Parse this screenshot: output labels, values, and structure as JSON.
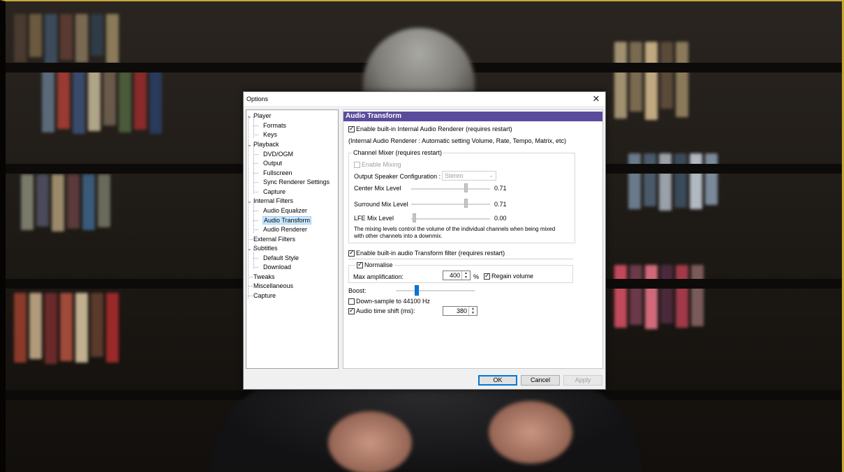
{
  "dialog": {
    "title": "Options",
    "close_glyph": "✕"
  },
  "tree": {
    "items": [
      {
        "label": "Player",
        "expanded": true
      },
      {
        "label": "Formats"
      },
      {
        "label": "Keys"
      },
      {
        "label": "Playback",
        "expanded": true
      },
      {
        "label": "DVD/OGM"
      },
      {
        "label": "Output"
      },
      {
        "label": "Fullscreen"
      },
      {
        "label": "Sync Renderer Settings"
      },
      {
        "label": "Capture"
      },
      {
        "label": "Internal Filters",
        "expanded": true
      },
      {
        "label": "Audio Equalizer"
      },
      {
        "label": "Audio Transform",
        "selected": true
      },
      {
        "label": "Audio Renderer"
      },
      {
        "label": "External Filters"
      },
      {
        "label": "Subtitles",
        "expanded": true
      },
      {
        "label": "Default Style"
      },
      {
        "label": "Download"
      },
      {
        "label": "Tweaks"
      },
      {
        "label": "Miscellaneous"
      },
      {
        "label": "Capture"
      }
    ],
    "expander_glyph": "⌄"
  },
  "panel": {
    "header": "Audio Transform",
    "enable_renderer": {
      "label": "Enable built-in Internal  Audio Renderer (requires restart)",
      "checked": true
    },
    "renderer_note": "(Internal Audio Renderer : Automatic setting Volume, Rate, Tempo, Matrix, etc)",
    "channel_mixer": {
      "group_label": "Channel Mixer (requires restart)",
      "enable_mixing": {
        "label": "Enable Mixing",
        "checked": false
      },
      "speaker_config_label": "Output Speaker Configuration :",
      "speaker_config_value": "Stereo",
      "center_label": "Center Mix Level",
      "center_value": "0.71",
      "surround_label": "Surround Mix Level",
      "surround_value": "0.71",
      "lfe_label": "LFE Mix Level",
      "lfe_value": "0.00",
      "note": "The mixing levels control the volume of the individual channels when being mixed with other channels into a downmix."
    },
    "enable_transform": {
      "label": "Enable built-in audio Transform filter (requires restart)",
      "checked": true
    },
    "normalise": {
      "label": "Normalise",
      "checked": true
    },
    "max_amp_label": "Max amplification:",
    "max_amp_value": "400",
    "max_amp_unit": "%",
    "regain_volume": {
      "label": "Regain volume",
      "checked": true
    },
    "boost_label": "Boost:",
    "downsample": {
      "label": "Down-sample to 44100 Hz",
      "checked": false
    },
    "time_shift": {
      "label": "Audio time shift (ms):",
      "checked": true
    },
    "time_shift_value": "380"
  },
  "buttons": {
    "ok": "OK",
    "cancel": "Cancel",
    "apply": "Apply"
  }
}
